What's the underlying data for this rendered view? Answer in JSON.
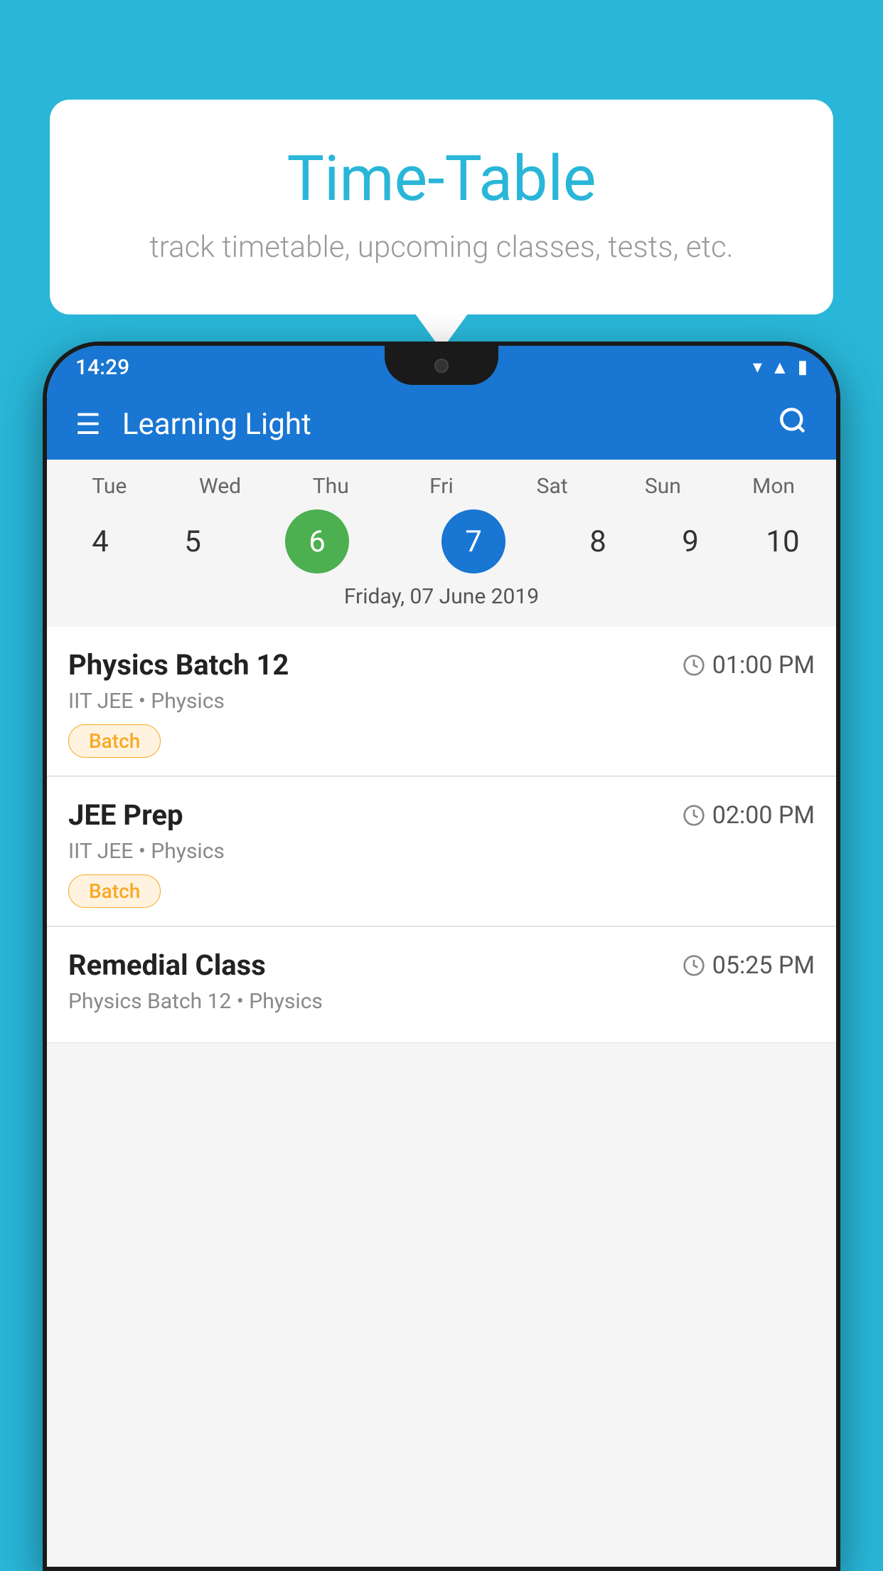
{
  "background_color": "#29B6D8",
  "tooltip": {
    "title": "Time-Table",
    "subtitle": "track timetable, upcoming classes, tests, etc."
  },
  "phone": {
    "status_bar": {
      "time": "14:29"
    },
    "app_bar": {
      "title": "Learning Light",
      "menu_icon": "☰",
      "search_icon": "🔍"
    },
    "calendar": {
      "days": [
        "Tue",
        "Wed",
        "Thu",
        "Fri",
        "Sat",
        "Sun",
        "Mon"
      ],
      "numbers": [
        "4",
        "5",
        "6",
        "7",
        "8",
        "9",
        "10"
      ],
      "today_index": 2,
      "selected_index": 3,
      "date_label": "Friday, 07 June 2019"
    },
    "classes": [
      {
        "name": "Physics Batch 12",
        "time": "01:00 PM",
        "subtitle": "IIT JEE • Physics",
        "badge": "Batch"
      },
      {
        "name": "JEE Prep",
        "time": "02:00 PM",
        "subtitle": "IIT JEE • Physics",
        "badge": "Batch"
      },
      {
        "name": "Remedial Class",
        "time": "05:25 PM",
        "subtitle": "Physics Batch 12 • Physics",
        "badge": null
      }
    ]
  }
}
